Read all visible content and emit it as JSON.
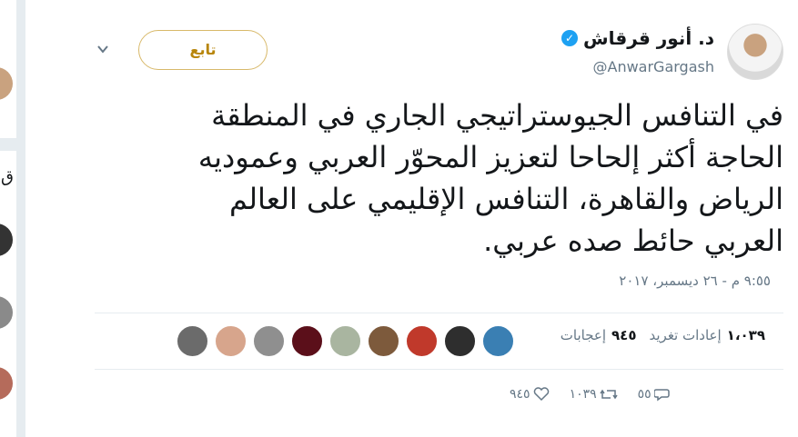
{
  "author": {
    "display_name": "د. أنور قرقاش",
    "handle": "@AnwarGargash",
    "verified": true
  },
  "follow_button_label": "تابع",
  "tweet_lines": [
    "في التنافس الجيوستراتيجي الجاري في المنطقة",
    "الحاجة أكثر إلحاحا لتعزيز المحوّر العربي وعموديه",
    "الرياض والقاهرة، التنافس الإقليمي على العالم",
    "العربي حائط صده عربي."
  ],
  "timestamp": "٩:٥٥ م - ٢٦ ديسمبر، ٢٠١٧",
  "stats": {
    "retweets_value": "١،٠٣٩",
    "retweets_label": "إعادات تغريد",
    "likes_value": "٩٤٥",
    "likes_label": "إعجابات"
  },
  "liker_colors": [
    "#3a7fb3",
    "#2e2e2e",
    "#c0392b",
    "#7d5a3c",
    "#a9b5a0",
    "#5b0f1a",
    "#8f8f8f",
    "#d7a58c",
    "#6b6b6b"
  ],
  "actions": {
    "reply_count": "٥٥",
    "retweet_count": "١٠٣٩",
    "like_count": "٩٤٥"
  },
  "colors": {
    "accent": "#1da1f2",
    "follow_border": "#d8b96a",
    "muted": "#657786"
  }
}
